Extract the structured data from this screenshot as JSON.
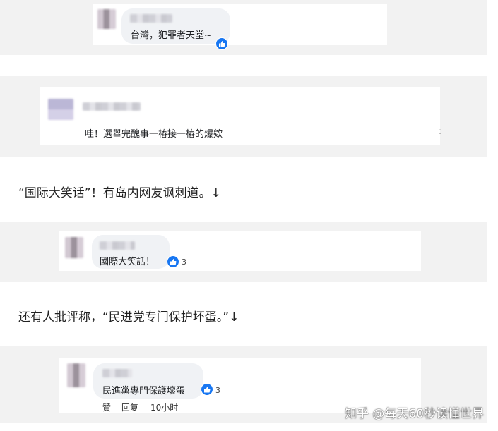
{
  "comments": [
    {
      "text": "台灣，犯罪者天堂~"
    },
    {
      "text": "哇！選舉完醜事一樁接一樁的爆欸"
    },
    {
      "text": "國際大笑話！",
      "likes": "3"
    },
    {
      "text": "民進黨專門保護壞蛋",
      "likes": "3",
      "actions": [
        "贊",
        "回复"
      ],
      "time": "10小时"
    }
  ],
  "article": {
    "para1": "“国际大笑话”！有岛内网友讽刺道。↓",
    "para2": "还有人批评称，“民进党专门保护坏蛋。”↓"
  },
  "watermark": "知乎 @每天60秒读懂世界",
  "side_mark": ":",
  "colors": {
    "like_blue": "#1877f2",
    "band_gray": "#f2f2f2",
    "bubble_gray": "#f0f2f5"
  },
  "icons": {
    "like": "thumbs-up-icon"
  }
}
